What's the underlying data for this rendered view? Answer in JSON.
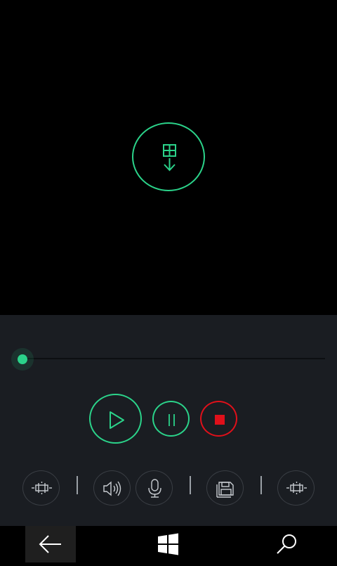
{
  "icons": {
    "import": "import-to-device-icon",
    "play": "play-icon",
    "pause": "pause-icon",
    "stop": "stop-icon",
    "trim_left": "trim-icon",
    "volume": "volume-icon",
    "microphone": "microphone-icon",
    "save": "save-icon",
    "trim_right": "trim-icon",
    "nav_back": "back-arrow-icon",
    "nav_start": "windows-logo-icon",
    "nav_search": "search-icon"
  },
  "playback": {
    "progress": 0.0
  },
  "colors": {
    "accent": "#2bd38a",
    "stop": "#e0101a",
    "panel": "#1a1d22",
    "background": "#000000"
  }
}
